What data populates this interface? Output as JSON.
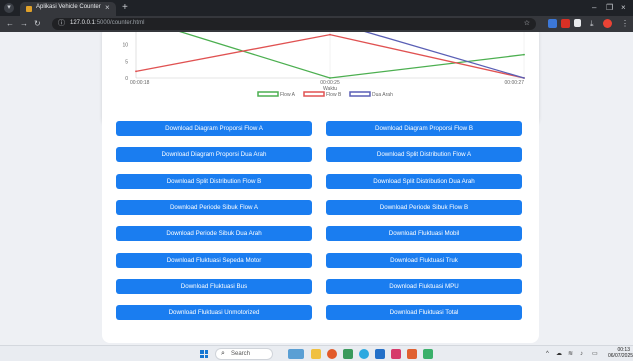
{
  "browser": {
    "tab_title": "Aplikasi Vehicle Counter",
    "url_host": "127.0.0.1",
    "url_rest": ":5000/counter.html",
    "icons": [
      "menu-icon",
      "close-icon",
      "new-tab-icon",
      "minimize-icon",
      "maximize-icon",
      "back-icon",
      "forward-icon",
      "reload-icon",
      "site-info-icon",
      "star-icon"
    ]
  },
  "chart_data": {
    "type": "line",
    "xlabel": "Waktu",
    "ylabel": "",
    "x_ticks": [
      "00:00:18",
      "00:00:25",
      "00:00:27"
    ],
    "y_ticks": [
      "0",
      "5",
      "10"
    ],
    "ylim": [
      0,
      15
    ],
    "x": [
      "00:00:18",
      "00:00:25",
      "00:00:27"
    ],
    "series": [
      {
        "name": "Flow A",
        "color": "#4caf50",
        "values": [
          18,
          0,
          7
        ]
      },
      {
        "name": "Flow B",
        "color": "#e05252",
        "values": [
          2,
          13,
          0
        ]
      },
      {
        "name": "Dua Arah",
        "color": "#5a5fb5",
        "values": [
          null,
          17,
          0
        ]
      }
    ],
    "legend_position": "bottom",
    "grid": false
  },
  "buttons": [
    {
      "label": "Download Diagram Proporsi Flow A"
    },
    {
      "label": "Download Diagram Proporsi Flow B"
    },
    {
      "label": "Download Diagram Proporsi Dua Arah"
    },
    {
      "label": "Download Split Distribution Flow A"
    },
    {
      "label": "Download Split Distribution Flow B"
    },
    {
      "label": "Download Split Distribution Dua Arah"
    },
    {
      "label": "Download Periode Sibuk Flow A"
    },
    {
      "label": "Download Periode Sibuk Flow B"
    },
    {
      "label": "Download Periode Sibuk Dua Arah"
    },
    {
      "label": "Download Fluktuasi Mobil"
    },
    {
      "label": "Download Fluktuasi Sepeda Motor"
    },
    {
      "label": "Download Fluktuasi Truk"
    },
    {
      "label": "Download Fluktuasi Bus"
    },
    {
      "label": "Download Fluktuasi MPU"
    },
    {
      "label": "Download Fluktuasi Unmotorized"
    },
    {
      "label": "Download Fluktuasi Total"
    }
  ],
  "taskbar": {
    "search_label": "Search",
    "time": "00:13",
    "date": "06/07/2025"
  },
  "colors": {
    "button": "#1a7df0",
    "page_bg": "#eef0f4",
    "chrome_dark": "#1f2227"
  }
}
